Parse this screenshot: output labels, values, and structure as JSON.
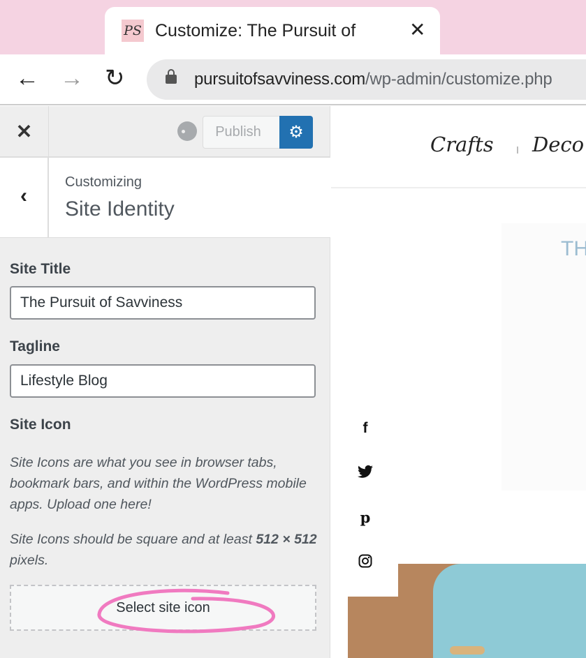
{
  "browser": {
    "tab_title": "Customize: The Pursuit of Savviness",
    "favicon_text": "PS",
    "url_domain": "pursuitofsavviness.com",
    "url_path": "/wp-admin/customize.php"
  },
  "customizer": {
    "publish_label": "Publish",
    "breadcrumb": "Customizing",
    "section_title": "Site Identity",
    "site_title_label": "Site Title",
    "site_title_value": "The Pursuit of Savviness",
    "tagline_label": "Tagline",
    "tagline_value": "Lifestyle Blog",
    "site_icon_label": "Site Icon",
    "site_icon_desc": "Site Icons are what you see in browser tabs, bookmark bars, and within the WordPress mobile apps. Upload one here!",
    "size_note_pre": "Site Icons should be square and at least ",
    "size_note_bold": "512 × 512",
    "size_note_post": " pixels.",
    "select_icon_label": "Select site icon",
    "accent_color": "#2271b1",
    "annotation_color": "#f07ac0"
  },
  "preview": {
    "menu": [
      "Crafts",
      "Deco"
    ],
    "hero_text": "TH",
    "social_icons": [
      "facebook-icon",
      "twitter-icon",
      "pinterest-icon",
      "instagram-icon"
    ]
  }
}
